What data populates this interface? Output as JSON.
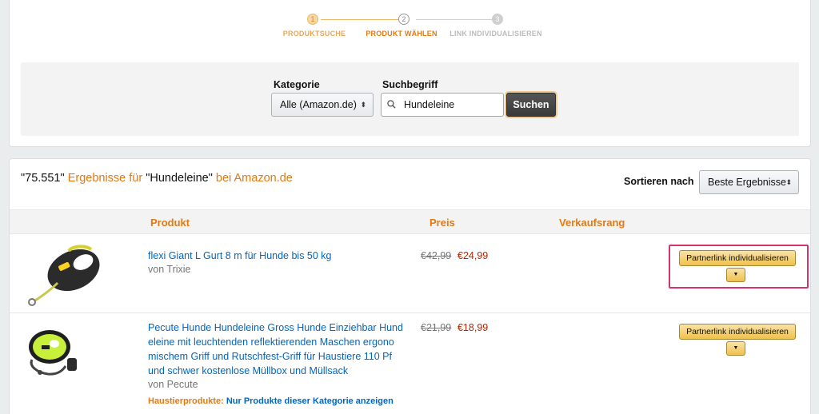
{
  "stepper": {
    "steps": [
      {
        "number": "1",
        "label": "PRODUKTSUCHE",
        "state": "done"
      },
      {
        "number": "2",
        "label": "PRODUKT WÄHLEN",
        "state": "current"
      },
      {
        "number": "3",
        "label": "LINK INDIVIDUALISIEREN",
        "state": "todo"
      }
    ]
  },
  "search": {
    "category_label": "Kategorie",
    "category_value": "Alle (Amazon.de)",
    "term_label": "Suchbegriff",
    "term_value": "Hundeleine",
    "submit_label": "Suchen"
  },
  "results": {
    "count": "\"75.551\"",
    "results_for": "Ergebnisse für",
    "query": "\"Hundeleine\"",
    "at_store": "bei Amazon.de",
    "sort_label": "Sortieren nach",
    "sort_value": "Beste Ergebnisse",
    "columns": {
      "product": "Produkt",
      "price": "Preis",
      "rank": "Verkaufsrang"
    },
    "items": [
      {
        "title": "flexi Giant L Gurt 8 m für Hunde bis 50 kg",
        "by": "von Trixie",
        "old_price": "€42,99",
        "new_price": "€24,99",
        "button_label": "Partnerlink individualisieren"
      },
      {
        "title": "Pecute Hunde Hundeleine Gross Hunde Einziehbar Hund eleine mit leuchtenden reflektierenden Maschen ergono mischem Griff und Rutschfest-Griff für Haustiere 110 Pf und schwer kostenlose Müllbox und Müllsack",
        "by": "von Pecute",
        "old_price": "€21,99",
        "new_price": "€18,99",
        "category_name": "Haustierprodukte:",
        "category_link": "Nur Produkte dieser Kategorie anzeigen",
        "button_label": "Partnerlink individualisieren"
      }
    ]
  },
  "colors": {
    "accent": "#e47911",
    "link": "#0066c0",
    "price": "#b12704",
    "highlight": "#d6336c"
  },
  "icons": [
    "search-icon",
    "caret-updown-icon",
    "caret-down-icon"
  ]
}
